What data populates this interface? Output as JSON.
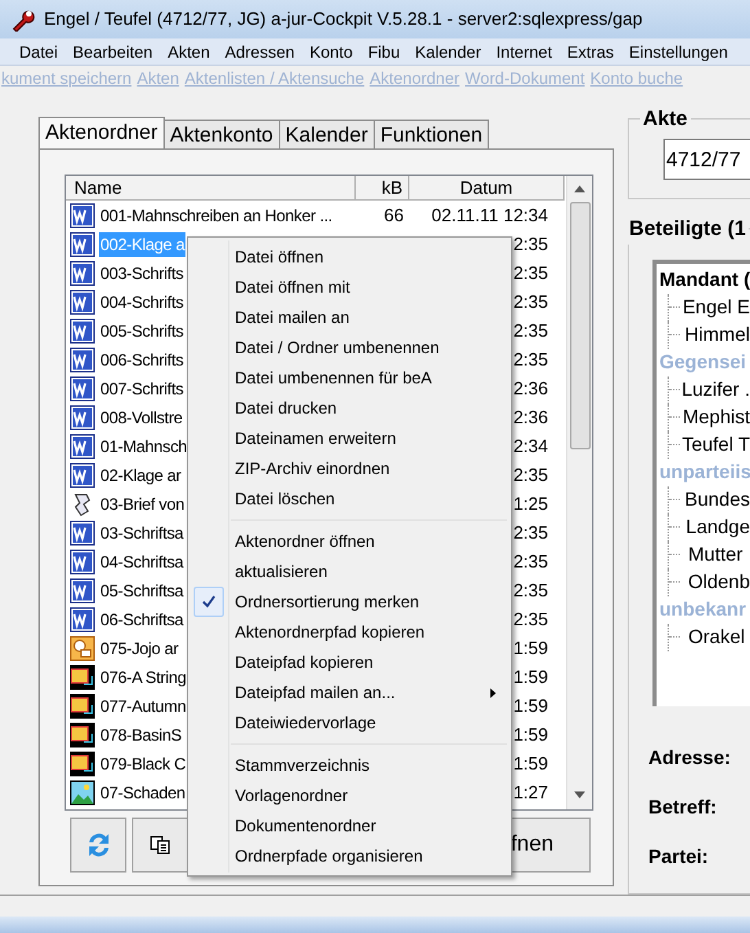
{
  "window": {
    "title": "Engel / Teufel (4712/77, JG) a-jur-Cockpit V.5.28.1 - server2:sqlexpress/gap"
  },
  "menu": [
    "Datei",
    "Bearbeiten",
    "Akten",
    "Adressen",
    "Konto",
    "Fibu",
    "Kalender",
    "Internet",
    "Extras",
    "Einstellungen"
  ],
  "toolbar_links": [
    "kument speichern",
    "Akten",
    "Aktenlisten / Aktensuche",
    "Aktenordner",
    "Word-Dokument",
    "Konto buche"
  ],
  "tabs": [
    {
      "label": "Aktenordner",
      "selected": true
    },
    {
      "label": "Aktenkonto",
      "selected": false
    },
    {
      "label": "Kalender",
      "selected": false
    },
    {
      "label": "Funktionen",
      "selected": false
    }
  ],
  "file_list": {
    "columns": [
      "Name",
      "kB",
      "Datum"
    ],
    "rows": [
      {
        "kind": "word",
        "name": "001-Mahnschreiben an Honker ...",
        "kb": "66",
        "date": "02.11.11 12:34",
        "selected": false
      },
      {
        "kind": "word",
        "name": "002-Klage a",
        "date": "2:35",
        "selected": true
      },
      {
        "kind": "word",
        "name": "003-Schrifts",
        "date": "2:35",
        "selected": false
      },
      {
        "kind": "word",
        "name": "004-Schrifts",
        "date": "2:35",
        "selected": false
      },
      {
        "kind": "word",
        "name": "005-Schrifts",
        "date": "2:35",
        "selected": false
      },
      {
        "kind": "word",
        "name": "006-Schrifts",
        "date": "2:35",
        "selected": false
      },
      {
        "kind": "word",
        "name": "007-Schrifts",
        "date": "2:36",
        "selected": false
      },
      {
        "kind": "word",
        "name": "008-Vollstre",
        "date": "2:36",
        "selected": false
      },
      {
        "kind": "word",
        "name": "01-Mahnsch",
        "date": "2:34",
        "selected": false
      },
      {
        "kind": "word",
        "name": "02-Klage ar",
        "date": "2:35",
        "selected": false
      },
      {
        "kind": "script",
        "name": "03-Brief von",
        "date": "1:25",
        "selected": false
      },
      {
        "kind": "word",
        "name": "03-Schriftsa",
        "date": "2:35",
        "selected": false
      },
      {
        "kind": "word",
        "name": "04-Schriftsa",
        "date": "2:35",
        "selected": false
      },
      {
        "kind": "word",
        "name": "05-Schriftsa",
        "date": "2:35",
        "selected": false
      },
      {
        "kind": "word",
        "name": "06-Schriftsa",
        "date": "2:35",
        "selected": false
      },
      {
        "kind": "presentation",
        "name": "075-Jojo ar",
        "date": "1:59",
        "selected": false
      },
      {
        "kind": "video",
        "name": "076-A String",
        "date": "1:59",
        "selected": false
      },
      {
        "kind": "video",
        "name": "077-Autumn",
        "date": "1:59",
        "selected": false
      },
      {
        "kind": "video",
        "name": "078-BasinS",
        "date": "1:59",
        "selected": false
      },
      {
        "kind": "video",
        "name": "079-Black C",
        "date": "1:59",
        "selected": false
      },
      {
        "kind": "image",
        "name": "07-Schaden",
        "date": "1:27",
        "selected": false
      }
    ]
  },
  "buttons": [
    {
      "kind": "refresh"
    },
    {
      "kind": "copy"
    },
    {
      "kind": "text",
      "label": "fnen"
    }
  ],
  "context_menu": [
    [
      {
        "label": "Datei öffnen"
      },
      {
        "label": "Datei öffnen mit"
      },
      {
        "label": "Datei mailen an"
      },
      {
        "label": "Datei / Ordner umbenennen"
      },
      {
        "label": "Datei umbenennen für beA"
      },
      {
        "label": "Datei drucken"
      },
      {
        "label": "Dateinamen erweitern"
      },
      {
        "label": "ZIP-Archiv einordnen"
      },
      {
        "label": "Datei löschen"
      }
    ],
    [
      {
        "label": "Aktenordner öffnen"
      },
      {
        "label": "aktualisieren"
      },
      {
        "label": "Ordnersortierung merken",
        "checked": true
      },
      {
        "label": "Aktenordnerpfad kopieren"
      },
      {
        "label": "Dateipfad kopieren"
      },
      {
        "label": "Dateipfad mailen an...",
        "submenu": true
      },
      {
        "label": "Dateiwiedervorlage"
      }
    ],
    [
      {
        "label": "Stammverzeichnis"
      },
      {
        "label": "Vorlagenordner"
      },
      {
        "label": "Dokumentenordner"
      },
      {
        "label": "Ordnerpfade organisieren"
      }
    ]
  ],
  "akte": {
    "legend": "Akte",
    "value": "4712/77"
  },
  "beteiligte": {
    "legend": "Beteiligte (1",
    "groups": [
      {
        "label": "Mandant (",
        "color": "#000000",
        "children": [
          {
            "label": "Engel E"
          },
          {
            "label": "Himmel"
          }
        ]
      },
      {
        "label": "Gegensei",
        "color": "#9bb3d6",
        "children": [
          {
            "label": "Luzifer ."
          },
          {
            "label": "Mephist"
          },
          {
            "label": "Teufel T"
          }
        ]
      },
      {
        "label": "unparteiis",
        "color": "#9bb3d6",
        "children": [
          {
            "label": "Bundes"
          },
          {
            "label": "Landge"
          },
          {
            "label": "Mutter"
          },
          {
            "label": "Oldenb"
          }
        ]
      },
      {
        "label": "unbekanr",
        "color": "#9bb3d6",
        "children": [
          {
            "label": "Orakel"
          }
        ]
      }
    ]
  },
  "details": [
    "Adresse:",
    "Betreff:",
    "Partei:"
  ]
}
